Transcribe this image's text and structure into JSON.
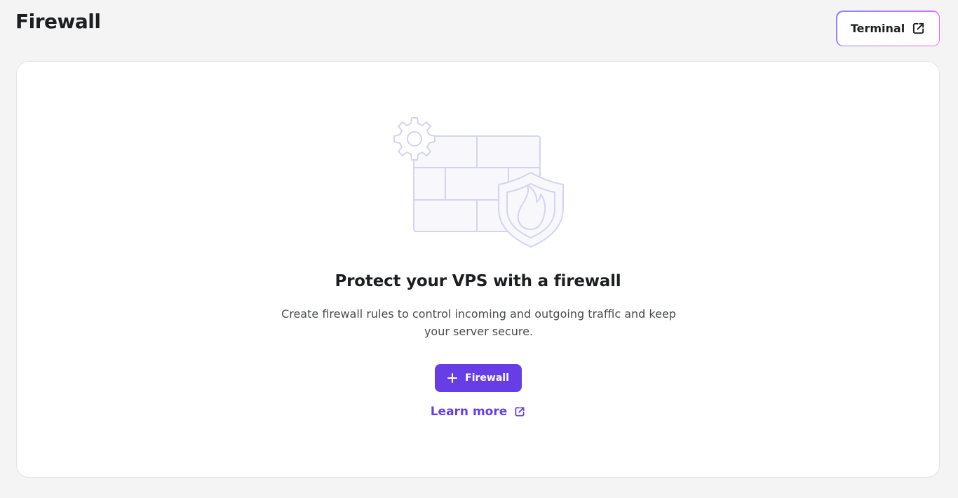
{
  "header": {
    "title": "Firewall",
    "terminal_button": {
      "label": "Terminal",
      "icon": "external-link-icon"
    }
  },
  "empty_state": {
    "illustration": "firewall-brick-wall-shield-gear-illustration",
    "title": "Protect your VPS with a firewall",
    "description": "Create firewall rules to control incoming and outgoing traffic and keep your server secure.",
    "primary_button": {
      "label": "Firewall",
      "icon": "plus-icon"
    },
    "link": {
      "label": "Learn more",
      "icon": "external-link-icon"
    }
  },
  "colors": {
    "background": "#f4f4f5",
    "card": "#ffffff",
    "primary": "#673de6",
    "text": "#1d1e20",
    "muted_text": "#4a4b51",
    "illustration_stroke": "#d5d4f0",
    "illustration_fill": "#f7f7fc"
  }
}
